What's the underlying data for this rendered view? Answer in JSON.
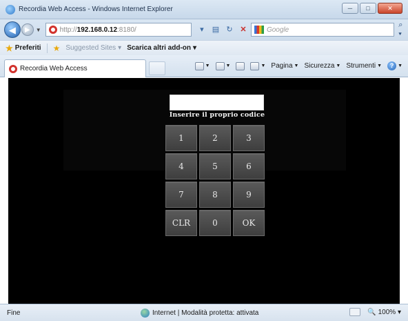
{
  "window": {
    "title": "Recordia Web Access - Windows Internet Explorer"
  },
  "address": {
    "proto": "http://",
    "host": "192.168.0.12",
    "port": ":8180/"
  },
  "search": {
    "placeholder": "Google"
  },
  "favorites": {
    "label": "Preferiti",
    "items": [
      "Suggested Sites",
      "Scarica altri add-on"
    ]
  },
  "tab": {
    "label": "Recordia Web Access"
  },
  "commands": {
    "page": "Pagina",
    "security": "Sicurezza",
    "tools": "Strumenti"
  },
  "login": {
    "prompt": "Inserire il proprio codice",
    "code_value": "",
    "keys": [
      "1",
      "2",
      "3",
      "4",
      "5",
      "6",
      "7",
      "8",
      "9",
      "CLR",
      "0",
      "OK"
    ]
  },
  "status": {
    "left": "Fine",
    "zone": "Internet | Modalità protetta: attivata",
    "zoom": "100%"
  },
  "colors": {
    "content_background": "#000000",
    "key_background": "#4a4a4a",
    "key_text": "#e8e8e8"
  }
}
